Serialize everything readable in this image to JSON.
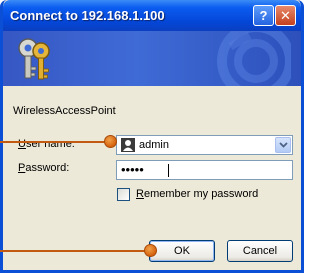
{
  "window": {
    "title": "Connect to 192.168.1.100",
    "help_glyph": "?",
    "close_glyph": "✕"
  },
  "banner": {
    "icon": "keys-icon"
  },
  "realm": "WirelessAccessPoint",
  "form": {
    "username_label_u": "U",
    "username_label_rest": "ser name:",
    "username_value": "admin",
    "password_label_u": "P",
    "password_label_rest": "assword:",
    "password_value": "•••••",
    "remember_label_u": "R",
    "remember_label_rest": "emember my password",
    "remember_checked": false
  },
  "buttons": {
    "ok": "OK",
    "cancel": "Cancel"
  },
  "colors": {
    "titlebar": "#0b5cf0",
    "banner": "#3f6bd6",
    "dialog_bg": "#ece9d8",
    "callout": "#d5620f"
  }
}
